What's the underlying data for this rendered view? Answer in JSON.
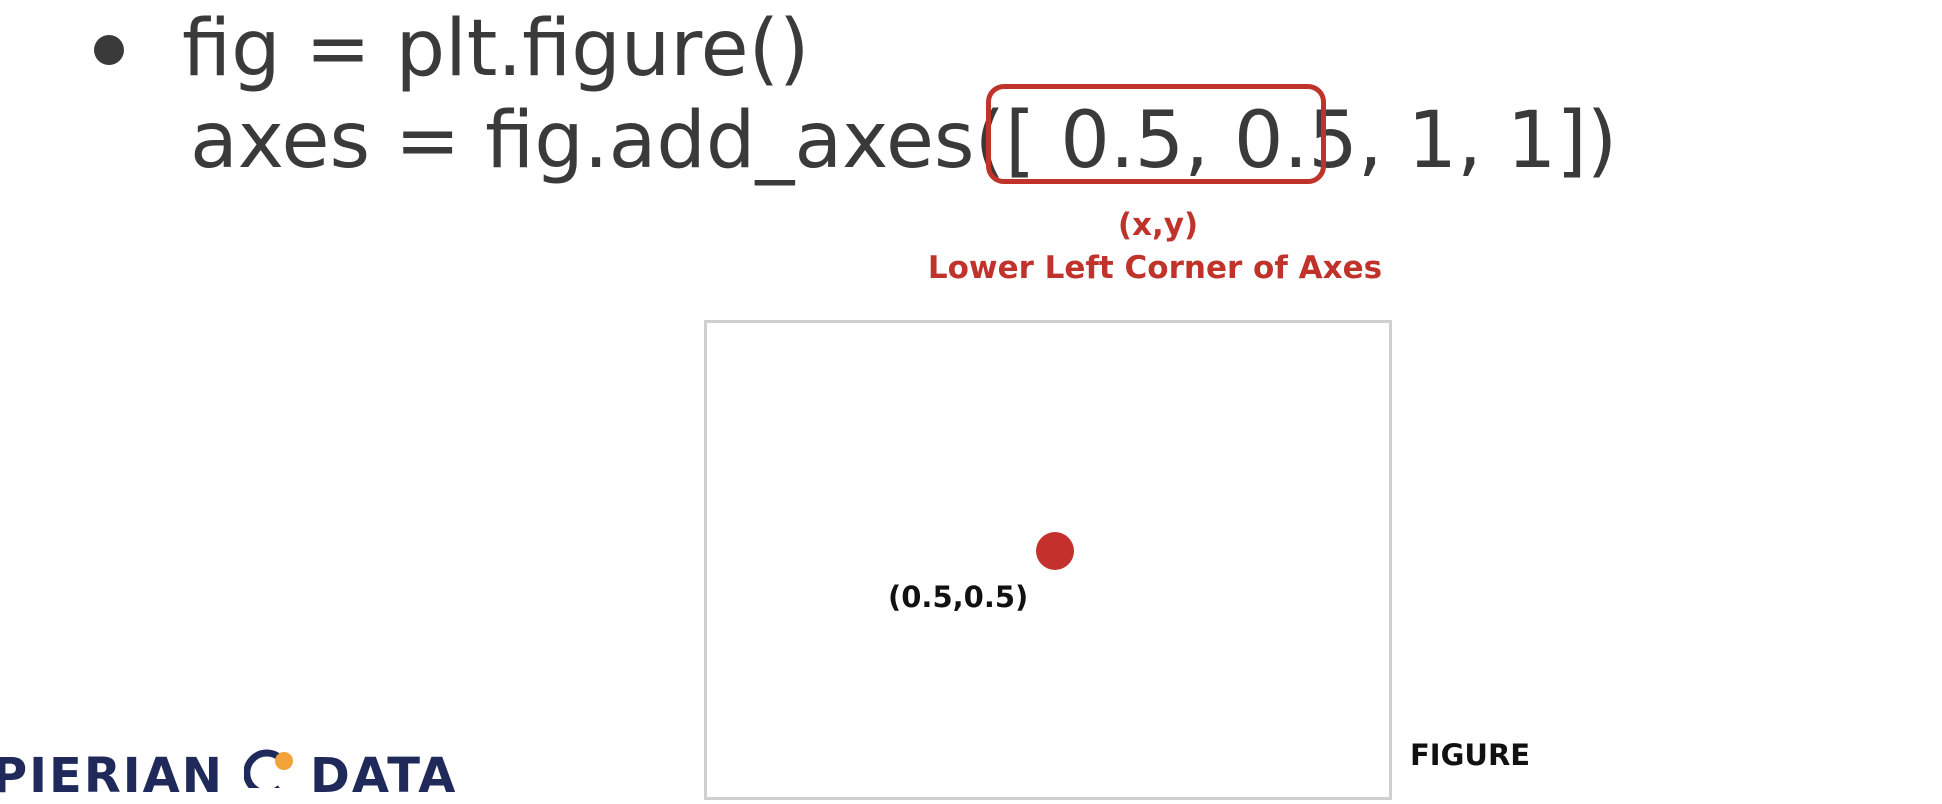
{
  "slide": {
    "line1": "fig = plt.figure()",
    "line2": "axes = fig.add_axes([ 0.5, 0.5, 1, 1])"
  },
  "annotation": {
    "xy": "(x,y)",
    "caption": "Lower Left Corner of Axes",
    "color": "#c0332b"
  },
  "diagram": {
    "point_label": "(0.5,0.5)",
    "figure_label": "FIGURE"
  },
  "logo": {
    "left_text": "PIERIAN",
    "right_text": "DATA",
    "primary_color": "#1f2a5a",
    "accent_color": "#f2a33a"
  },
  "icons": {
    "bullet": "bullet-dot-icon",
    "point": "corner-point-icon",
    "logo_mark": "logo-mark-icon"
  }
}
